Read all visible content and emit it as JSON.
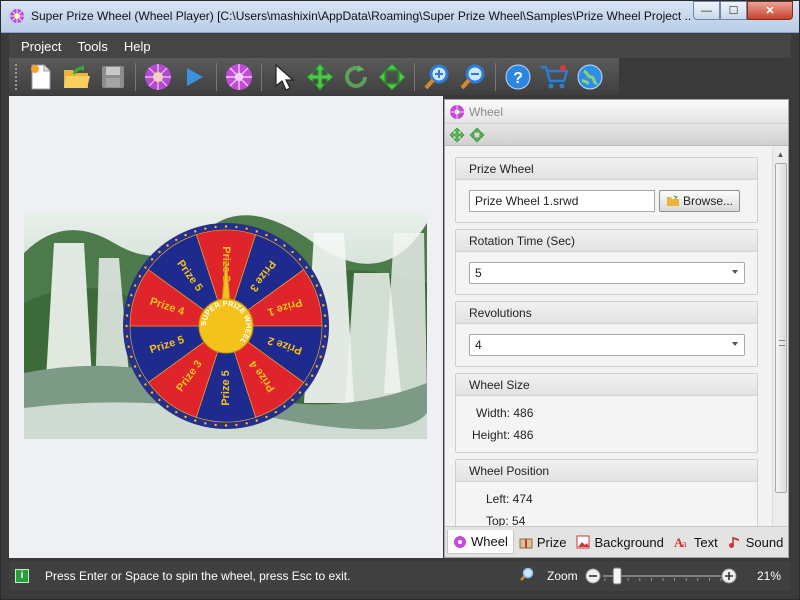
{
  "window": {
    "title": "Super Prize Wheel (Wheel Player) [C:\\Users\\mashixin\\AppData\\Roaming\\Super Prize Wheel\\Samples\\Prize Wheel Project ...",
    "minimize_label": "—",
    "maximize_label": "☐",
    "close_label": "✕"
  },
  "menu": [
    "Project",
    "Tools",
    "Help"
  ],
  "toolbar": {
    "icons": [
      "new-icon",
      "open-icon",
      "save-icon",
      "zoom-wheel-icon",
      "play-icon",
      "wheel-settings-icon",
      "pointer-icon",
      "move-icon",
      "rotate-icon",
      "resize-icon",
      "zoom-in-icon",
      "zoom-out-icon",
      "help-icon",
      "cart-icon",
      "web-icon"
    ]
  },
  "wheel": {
    "center_text": "SUPER PRIZE WHEEL",
    "segments": [
      "Prize 2",
      "Prize 3",
      "Prize 1",
      "Prize 2",
      "Prize 4",
      "Prize 5",
      "Prize 3",
      "Prize 5",
      "Prize 4",
      "Prize 5"
    ],
    "colors": {
      "red": "#e0242c",
      "blue": "#1f2a8e",
      "gold": "#f3c21b",
      "ring": "#272f8d"
    }
  },
  "panel": {
    "title": "Wheel",
    "groups": {
      "prize_wheel": {
        "label": "Prize Wheel",
        "file": "Prize Wheel 1.srwd",
        "browse_label": "Browse..."
      },
      "rotation_time": {
        "label": "Rotation Time (Sec)",
        "value": "5"
      },
      "revolutions": {
        "label": "Revolutions",
        "value": "4"
      },
      "wheel_size": {
        "label": "Wheel Size",
        "width": "Width: 486",
        "height": "Height: 486"
      },
      "wheel_position": {
        "label": "Wheel Position",
        "left": "Left: 474",
        "top": "Top: 54"
      }
    },
    "tabs": [
      "Wheel",
      "Prize",
      "Background",
      "Text",
      "Sound"
    ],
    "active_tab": "Wheel"
  },
  "status": {
    "message": "Press Enter or Space to spin the wheel, press Esc to exit.",
    "zoom_label": "Zoom",
    "zoom_value": "21%",
    "zoom_fraction": 0.12
  }
}
